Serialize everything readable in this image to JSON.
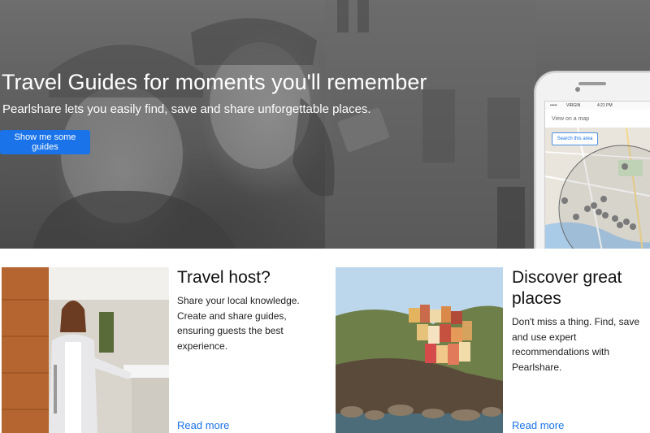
{
  "hero": {
    "title": "Travel Guides for moments you'll remember",
    "subtitle": "Pearlshare lets you easily find, save and share unforgettable places.",
    "cta_label": "Show me some guides"
  },
  "phone": {
    "carrier": "VIRGIN",
    "time": "4:21 PM",
    "map_header": "View on a map",
    "search_area_label": "Search this area"
  },
  "cards": [
    {
      "title": "Travel host?",
      "text": "Share your local knowledge. Create and share guides, ensuring guests the best experience.",
      "link_label": "Read more"
    },
    {
      "title": "Discover great places",
      "text": "Don't miss a thing. Find, save and use expert recommendations with Pearlshare.",
      "link_label": "Read more"
    }
  ],
  "colors": {
    "accent": "#1a73e8",
    "hero_overlay": "#5a5a5a"
  }
}
